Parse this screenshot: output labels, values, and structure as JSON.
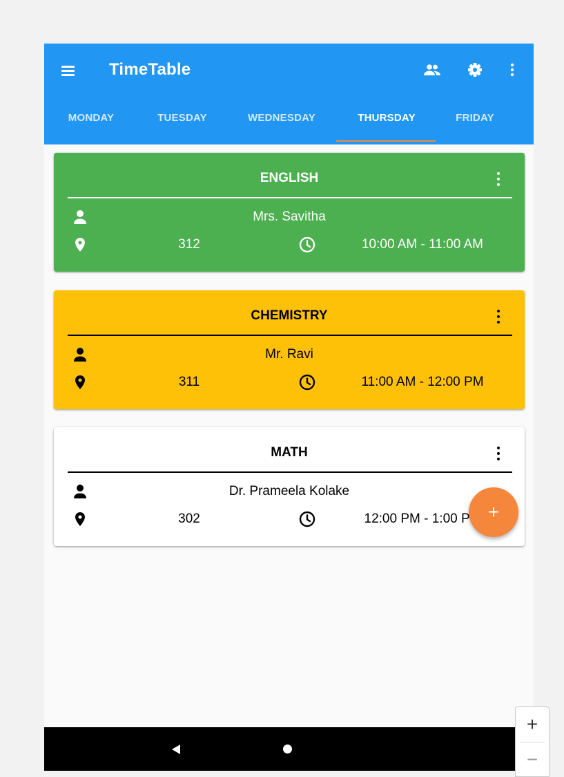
{
  "app": {
    "title": "TimeTable"
  },
  "tabs": [
    {
      "label": "MONDAY"
    },
    {
      "label": "TUESDAY"
    },
    {
      "label": "WEDNESDAY"
    },
    {
      "label": "THURSDAY",
      "active": true
    },
    {
      "label": "FRIDAY"
    }
  ],
  "classes": [
    {
      "subject": "ENGLISH",
      "teacher": "Mrs. Savitha",
      "room": "312",
      "time": "10:00 AM - 11:00 AM",
      "color": "#4caf50",
      "text_color": "#ffffff"
    },
    {
      "subject": "CHEMISTRY",
      "teacher": "Mr. Ravi",
      "room": "311",
      "time": "11:00 AM - 12:00 PM",
      "color": "#ffc107",
      "text_color": "#000000"
    },
    {
      "subject": "MATH",
      "teacher": "Dr. Prameela Kolake",
      "room": "302",
      "time": "12:00 PM - 1:00 PM",
      "color": "#ffffff",
      "text_color": "#000000"
    }
  ],
  "fab": {
    "label": "+"
  },
  "zoom": {
    "in_label": "+",
    "out_label": "−"
  },
  "colors": {
    "appbar": "#2196f3",
    "accent": "#f4873c"
  },
  "icons": {
    "appbar": [
      "menu-icon",
      "people-icon",
      "settings-icon",
      "more-vert-icon"
    ],
    "card": [
      "person-icon",
      "location-pin-icon",
      "clock-icon",
      "more-vert-icon"
    ],
    "navbar": [
      "back-icon",
      "home-icon"
    ]
  }
}
